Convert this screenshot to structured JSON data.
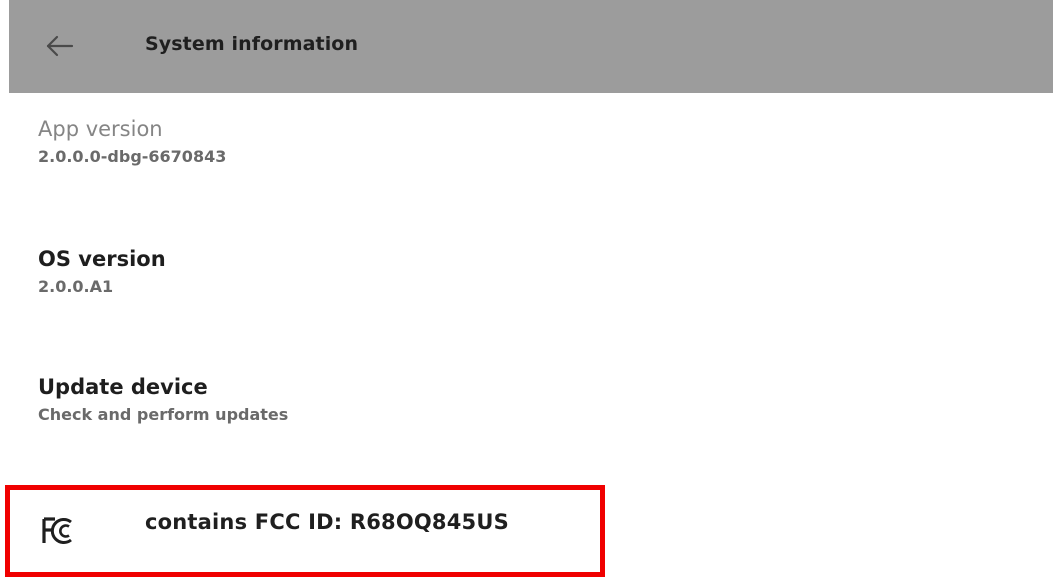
{
  "header": {
    "title": "System information",
    "back_icon": "arrow-left-icon"
  },
  "items": [
    {
      "title": "App version",
      "subtitle": "2.0.0.0-dbg-6670843"
    },
    {
      "title": "OS version",
      "subtitle": "2.0.0.A1"
    },
    {
      "title": "Update device",
      "subtitle": "Check and perform updates"
    }
  ],
  "fcc": {
    "logo_icon": "fcc-logo-icon",
    "text": "contains FCC ID: R68OQ845US",
    "highlight_color": "#f00000"
  },
  "colors": {
    "header_bg": "#9c9c9c",
    "background": "#ffffff"
  }
}
